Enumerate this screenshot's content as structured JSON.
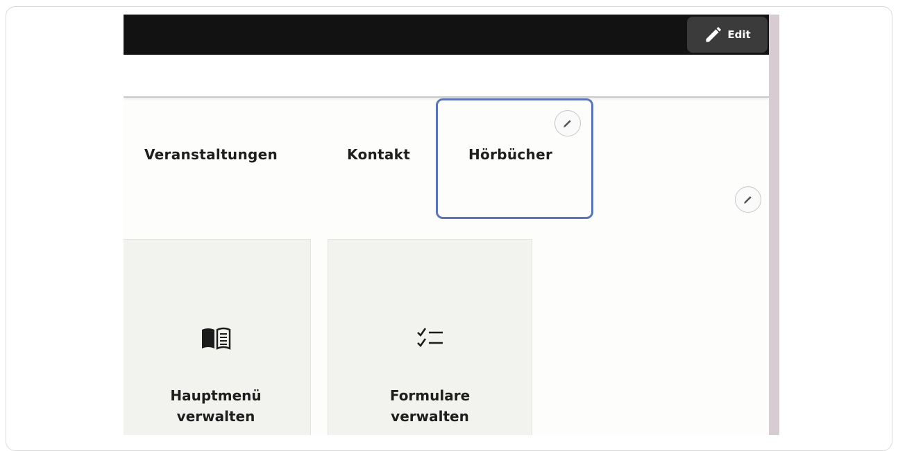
{
  "toolbar": {
    "edit_label": "Edit"
  },
  "nav": {
    "items": [
      {
        "label": "Veranstaltungen"
      },
      {
        "label": "Kontakt"
      },
      {
        "label": "Hörbücher"
      }
    ]
  },
  "cards": [
    {
      "title": "Hauptmenü\nverwalten",
      "icon": "open-book-icon"
    },
    {
      "title": "Formulare\nverwalten",
      "icon": "checklist-icon"
    }
  ],
  "colors": {
    "topbar": "#121212",
    "edit_button": "#3b3b3b",
    "highlight_border": "#5a74b8",
    "card_bg": "#f2f2ef"
  }
}
